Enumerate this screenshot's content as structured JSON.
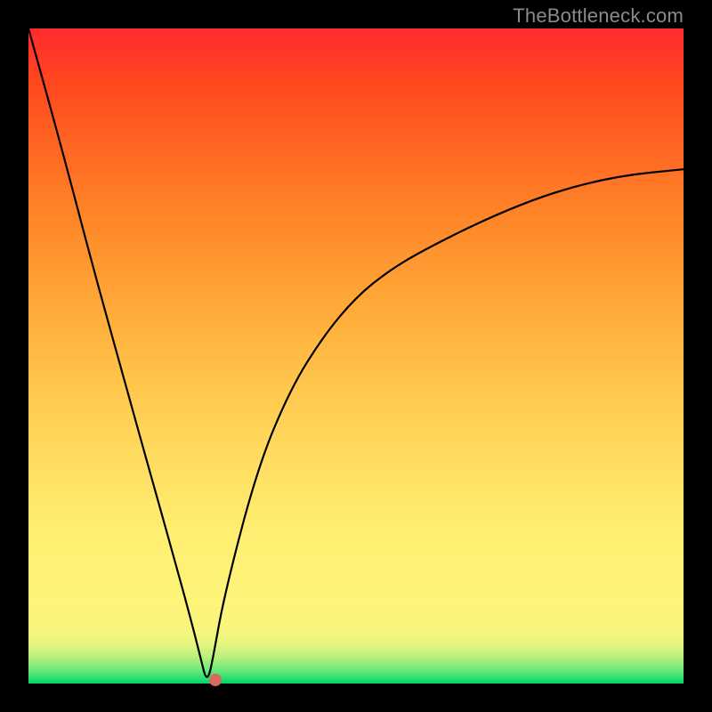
{
  "brand": {
    "watermark": "TheBottleneck.com"
  },
  "colors": {
    "curve": "#000000",
    "dot": "#d86a5a",
    "frame": "#000000"
  },
  "chart_data": {
    "type": "line",
    "title": "",
    "xlabel": "",
    "ylabel": "",
    "xlim": [
      0,
      100
    ],
    "ylim": [
      0,
      100
    ],
    "legend": false,
    "grid": false,
    "series": [
      {
        "name": "bottleneck-curve",
        "x": [
          0,
          5,
          10,
          15,
          20,
          22,
          25,
          26.5,
          27,
          27.5,
          28,
          30,
          35,
          40,
          45,
          50,
          55,
          60,
          70,
          80,
          90,
          100
        ],
        "y": [
          100,
          82,
          63,
          45,
          27,
          20,
          9,
          3,
          1,
          1,
          3,
          14,
          33,
          45,
          53,
          59,
          63,
          66,
          71,
          75,
          77.5,
          78.5
        ]
      }
    ],
    "annotations": [
      {
        "type": "point",
        "name": "minimum-marker",
        "x": 28.5,
        "y": 0.5,
        "color": "#d86a5a"
      }
    ],
    "background_gradient": {
      "direction": "vertical",
      "stops": [
        {
          "pos": 0,
          "color": "#00d66b"
        },
        {
          "pos": 22,
          "color": "#fff073"
        },
        {
          "pos": 52,
          "color": "#ffb741"
        },
        {
          "pos": 82,
          "color": "#ff6622"
        },
        {
          "pos": 100,
          "color": "#ff2a2f"
        }
      ]
    }
  }
}
